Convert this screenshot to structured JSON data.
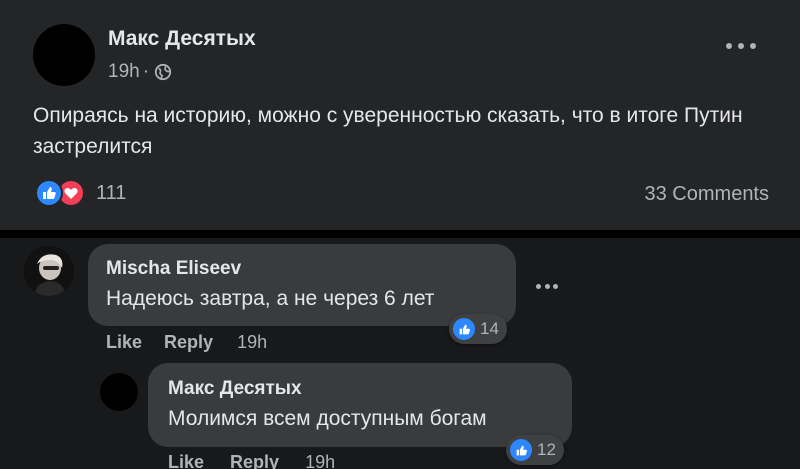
{
  "post": {
    "author": "Макс Десятых",
    "time": "19h",
    "separator": "·",
    "text": "Опираясь на историю, можно с уверенностью сказать, что в итоге Путин застрелится",
    "reactions_count": "111",
    "comments_count": "33 Comments"
  },
  "comments": [
    {
      "author": "Mischa Eliseev",
      "text": "Надеюсь завтра, а не через 6 лет",
      "likes": "14",
      "like_label": "Like",
      "reply_label": "Reply",
      "time": "19h"
    },
    {
      "author": "Макс Десятых",
      "text": "Молимся всем доступным богам",
      "likes": "12",
      "like_label": "Like",
      "reply_label": "Reply",
      "time": "19h"
    }
  ],
  "icons": {
    "more": "more-horizontal-icon",
    "globe": "globe-icon",
    "like": "thumbs-up-icon",
    "love": "heart-icon"
  },
  "colors": {
    "like_blue": "#2d88ff",
    "love_red": "#f33e58"
  }
}
